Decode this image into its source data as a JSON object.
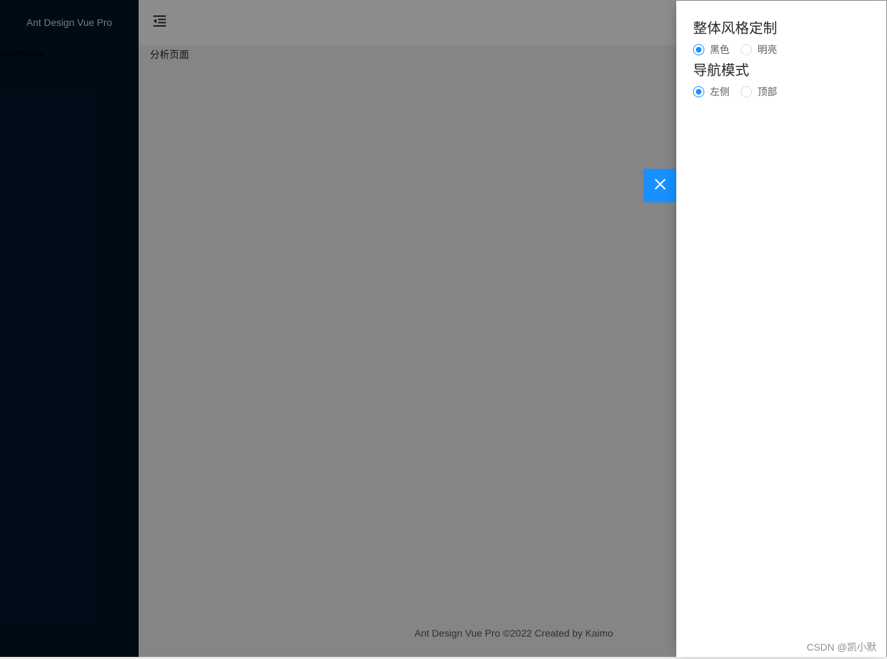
{
  "sider": {
    "logo_text": "Ant Design Vue Pro",
    "menu_text": "SiderMenu"
  },
  "main": {
    "page_text": "分析页面",
    "footer_text": "Ant Design Vue Pro ©2022 Created by Kaimo"
  },
  "drawer": {
    "sections": [
      {
        "title": "整体风格定制",
        "options": [
          {
            "label": "黑色",
            "checked": true
          },
          {
            "label": "明亮",
            "checked": false
          }
        ]
      },
      {
        "title": "导航模式",
        "options": [
          {
            "label": "左侧",
            "checked": true
          },
          {
            "label": "顶部",
            "checked": false
          }
        ]
      }
    ]
  },
  "watermark": "CSDN @凯小默",
  "colors": {
    "sider_bg": "#001529",
    "primary": "#1890ff"
  },
  "icons": {
    "menu_fold": "menu-fold-icon",
    "close": "close-icon"
  }
}
